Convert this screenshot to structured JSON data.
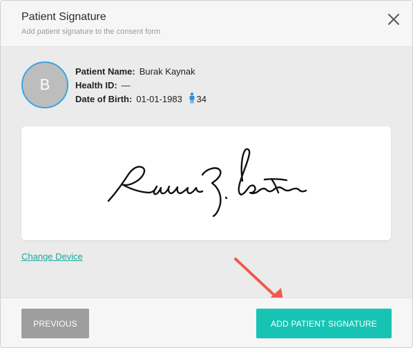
{
  "modal": {
    "title": "Patient Signature",
    "subtitle": "Add patient signature to the consent form",
    "close_icon": "close-icon"
  },
  "patient": {
    "avatar_initial": "B",
    "name_label": "Patient Name:",
    "name": "Burak Kaynak",
    "health_id_label": "Health ID:",
    "health_id": "—",
    "dob_label": "Date of Birth:",
    "dob": "01-01-1983",
    "age_icon": "person-icon",
    "age": "34"
  },
  "signature": {
    "change_device_label": "Change Device"
  },
  "footer": {
    "previous_label": "PREVIOUS",
    "add_signature_label": "ADD PATIENT SIGNATURE"
  },
  "colors": {
    "accent": "#17c4b4",
    "link": "#1aa6a0",
    "avatar_ring": "#3aa3e3",
    "secondary_button": "#9e9e9e",
    "annotation_arrow": "#ee5a4f"
  }
}
